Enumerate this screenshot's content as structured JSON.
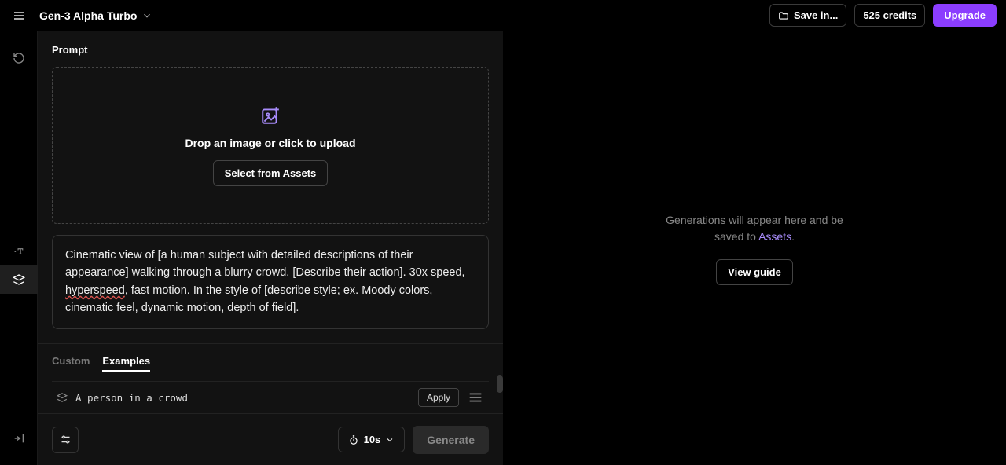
{
  "header": {
    "model_name": "Gen-3 Alpha Turbo",
    "save_label": "Save in...",
    "credits_label": "525 credits",
    "upgrade_label": "Upgrade"
  },
  "prompt": {
    "section_label": "Prompt",
    "dropzone_text": "Drop an image or click to upload",
    "select_assets_label": "Select from Assets",
    "text": "Cinematic view of [a human subject with detailed descriptions of their appearance] walking through a blurry crowd. [Describe their action]. 30x speed, hyperspeed, fast motion. In the style of [describe style; ex. Moody colors, cinematic feel, dynamic motion, depth of field]."
  },
  "tabs": {
    "custom": "Custom",
    "examples": "Examples"
  },
  "examples": [
    {
      "label": "A person in a crowd",
      "apply": "Apply"
    }
  ],
  "bottom": {
    "duration": "10s",
    "generate": "Generate"
  },
  "right": {
    "line1": "Generations will appear here and be",
    "line2_prefix": "saved to ",
    "line2_link": "Assets",
    "view_guide": "View guide"
  }
}
